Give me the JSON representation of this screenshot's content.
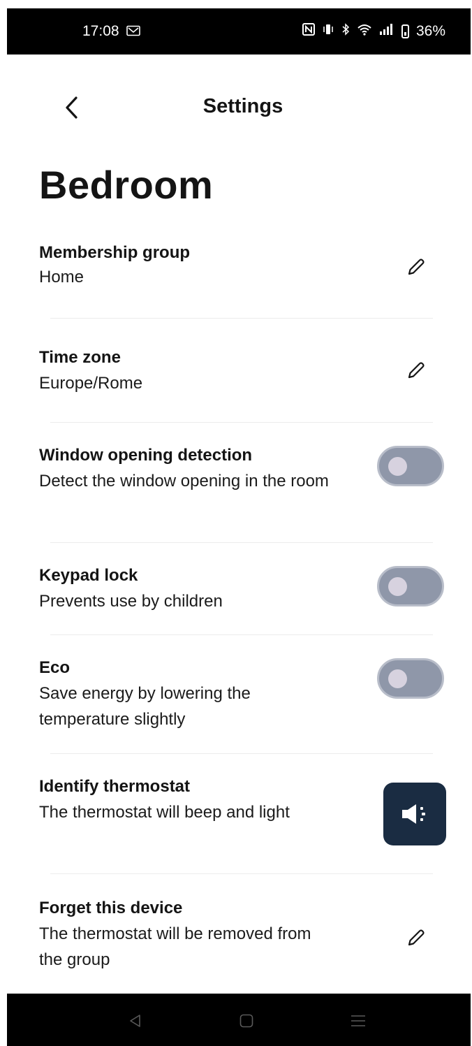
{
  "status_bar": {
    "time": "17:08",
    "battery": "36%",
    "icons": [
      "mail-icon",
      "nfc-icon",
      "vibrate-icon",
      "bluetooth-icon",
      "wifi-icon",
      "signal-icon",
      "battery-icon"
    ]
  },
  "header": {
    "back_icon": "chevron-left-icon",
    "title": "Settings"
  },
  "page": {
    "room_name": "Bedroom"
  },
  "settings": {
    "membership": {
      "label": "Membership group",
      "value": "Home",
      "icon": "pencil-icon"
    },
    "time_zone": {
      "label": "Time zone",
      "value": "Europe/Rome",
      "icon": "pencil-icon"
    },
    "window_detection": {
      "label": "Window opening detection",
      "description": "Detect the window opening in the room",
      "enabled": false
    },
    "keypad_lock": {
      "label": "Keypad lock",
      "description": "Prevents use by children",
      "enabled": false
    },
    "eco": {
      "label": "Eco",
      "description": "Save energy by lowering the temperature slightly",
      "enabled": false
    },
    "identify": {
      "label": "Identify thermostat",
      "description": "The thermostat will beep and light",
      "icon": "speaker-icon"
    },
    "forget": {
      "label": "Forget this device",
      "description": "The thermostat will be removed from the group",
      "icon": "pencil-icon"
    }
  },
  "colors": {
    "toggle_off": "#8f97a9",
    "toggle_border": "#b8bdc9",
    "accent_button": "#1a2c42"
  },
  "nav_bar": {
    "buttons": [
      "back-triangle-icon",
      "home-square-icon",
      "menu-lines-icon"
    ]
  }
}
